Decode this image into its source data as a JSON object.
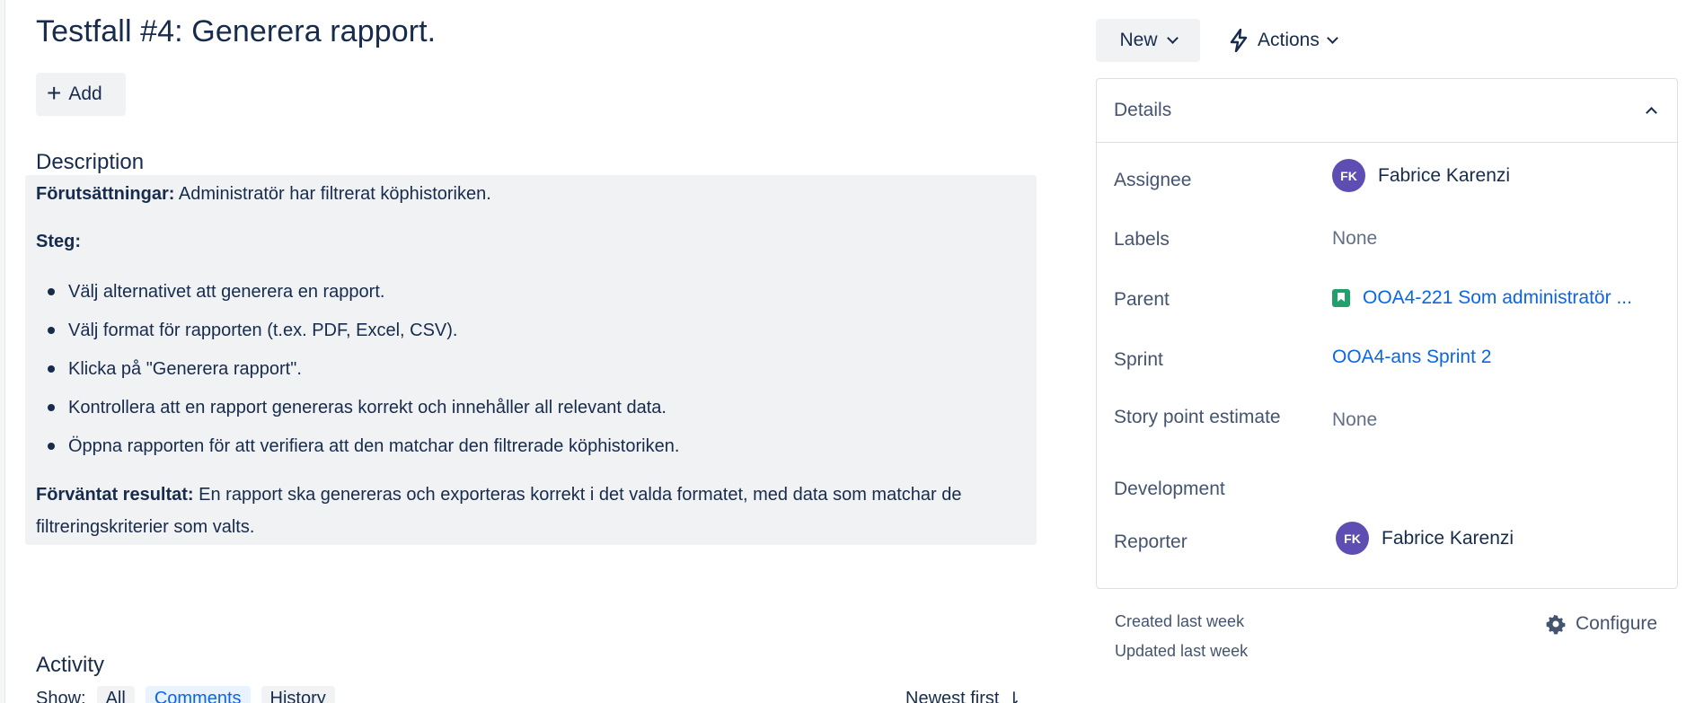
{
  "issue": {
    "title": "Testfall #4: Generera rapport.",
    "add_label": "Add"
  },
  "description": {
    "heading": "Description",
    "preconditions_label": "Förutsättningar:",
    "preconditions_text": " Administratör har filtrerat köphistoriken.",
    "steps_label": "Steg:",
    "steps": [
      "Välj alternativet att generera en rapport.",
      "Välj format för rapporten (t.ex. PDF, Excel, CSV).",
      "Klicka på \"Generera rapport\".",
      "Kontrollera att en rapport genereras korrekt och innehåller all relevant data.",
      "Öppna rapporten för att verifiera att den matchar den filtrerade köphistoriken."
    ],
    "expected_label": "Förväntat resultat:",
    "expected_text": " En rapport ska genereras och exporteras korrekt i det valda formatet, med data som matchar de filtreringskriterier som valts."
  },
  "activity": {
    "heading": "Activity",
    "show_label": "Show:",
    "filters": [
      "All",
      "Comments",
      "History"
    ],
    "sort_label": "Newest first"
  },
  "toolbar": {
    "status_label": "New",
    "actions_label": "Actions"
  },
  "details": {
    "title": "Details",
    "fields": {
      "assignee": {
        "label": "Assignee",
        "initials": "FK",
        "name": "Fabrice Karenzi"
      },
      "labels": {
        "label": "Labels",
        "value": "None"
      },
      "parent": {
        "label": "Parent",
        "value": "OOA4-221 Som administratör ..."
      },
      "sprint": {
        "label": "Sprint",
        "value": "OOA4-ans Sprint 2"
      },
      "story_points": {
        "label": "Story point estimate",
        "value": "None"
      },
      "development": {
        "label": "Development"
      },
      "reporter": {
        "label": "Reporter",
        "initials": "FK",
        "name": "Fabrice Karenzi"
      }
    },
    "created": "Created last week",
    "updated": "Updated last week",
    "configure_label": "Configure"
  },
  "colors": {
    "text": "#172b4d",
    "link": "#0c66e4",
    "avatar": "#5e4db2",
    "story": "#22a06b",
    "surface": "#f1f2f4"
  }
}
